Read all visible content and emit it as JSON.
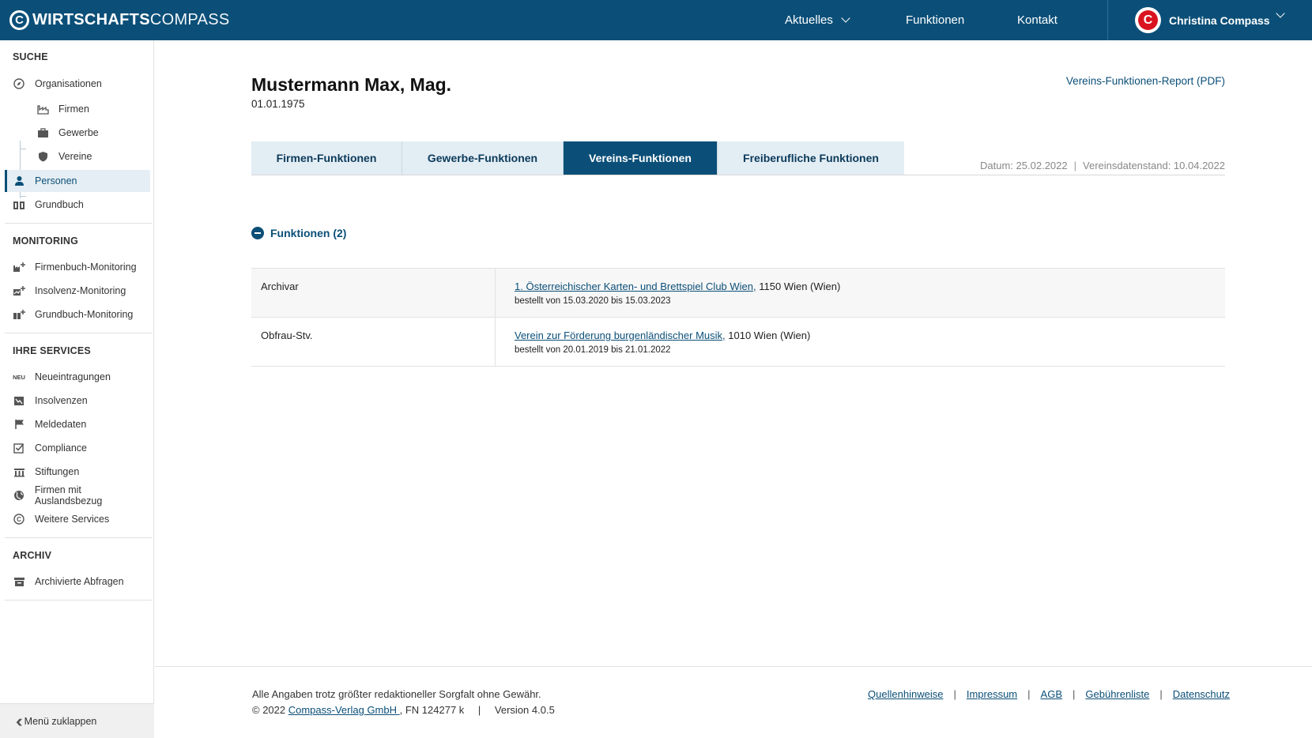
{
  "header": {
    "logo_bold": "WIRTSCHAFTS",
    "logo_light": "COMPASS",
    "nav": {
      "aktuelles": "Aktuelles",
      "funktionen": "Funktionen",
      "kontakt": "Kontakt"
    },
    "user_name": "Christina Compass",
    "brand_color": "#0b4f78",
    "accent_color": "#d9141f"
  },
  "sidebar": {
    "sections": {
      "suche": "SUCHE",
      "monitoring": "MONITORING",
      "services": "IHRE SERVICES",
      "archiv": "ARCHIV"
    },
    "suche_items": [
      {
        "label": "Organisationen",
        "icon": "compass-icon"
      },
      {
        "label": "Firmen",
        "icon": "factory-icon"
      },
      {
        "label": "Gewerbe",
        "icon": "briefcase-icon"
      },
      {
        "label": "Vereine",
        "icon": "shield-icon"
      },
      {
        "label": "Personen",
        "icon": "person-icon"
      },
      {
        "label": "Grundbuch",
        "icon": "book-icon"
      }
    ],
    "monitoring_items": [
      {
        "label": "Firmenbuch-Monitoring"
      },
      {
        "label": "Insolvenz-Monitoring"
      },
      {
        "label": "Grundbuch-Monitoring"
      }
    ],
    "services_items": [
      {
        "label": "Neueintragungen",
        "badge": "NEU"
      },
      {
        "label": "Insolvenzen"
      },
      {
        "label": "Meldedaten"
      },
      {
        "label": "Compliance"
      },
      {
        "label": "Stiftungen"
      },
      {
        "label": "Firmen mit Auslandsbezug"
      },
      {
        "label": "Weitere Services"
      }
    ],
    "archiv_items": [
      {
        "label": "Archivierte Abfragen"
      }
    ],
    "collapse_label": "Menü zuklappen"
  },
  "main": {
    "person_name": "Mustermann Max, Mag.",
    "person_dob": "01.01.1975",
    "report_link": "Vereins-Funktionen-Report (PDF)",
    "tabs": [
      {
        "label": "Firmen-Funktionen"
      },
      {
        "label": "Gewerbe-Funktionen"
      },
      {
        "label": "Vereins-Funktionen",
        "active": true
      },
      {
        "label": "Freiberufliche Funktionen"
      }
    ],
    "datum": "Datum: 25.02.2022",
    "vereinsdatenstand": "Vereinsdatenstand: 10.04.2022",
    "section_title": "Funktionen (2)",
    "functions": [
      {
        "role": "Archivar",
        "org_name": "1. Österreichischer Karten- und Brettspiel Club Wien,",
        "location": " 1150 Wien (Wien)",
        "period": "bestellt von 15.03.2020 bis 15.03.2023"
      },
      {
        "role": "Obfrau-Stv.",
        "org_name": "Verein zur Förderung burgenländischer Musik,",
        "location": " 1010 Wien (Wien)",
        "period": "bestellt von 20.01.2019 bis 21.01.2022"
      }
    ]
  },
  "footer": {
    "disclaimer": "Alle Angaben trotz größter redaktioneller Sorgfalt ohne Gewähr.",
    "copyright_prefix": "© 2022 ",
    "company_link": "Compass-Verlag GmbH ",
    "copyright_suffix": ", FN 124277 k",
    "version_sep": "|",
    "version": "Version 4.0.5",
    "links": [
      "Quellenhinweise",
      "Impressum",
      "AGB",
      "Gebührenliste",
      "Datenschutz"
    ],
    "link_sep": "|"
  }
}
